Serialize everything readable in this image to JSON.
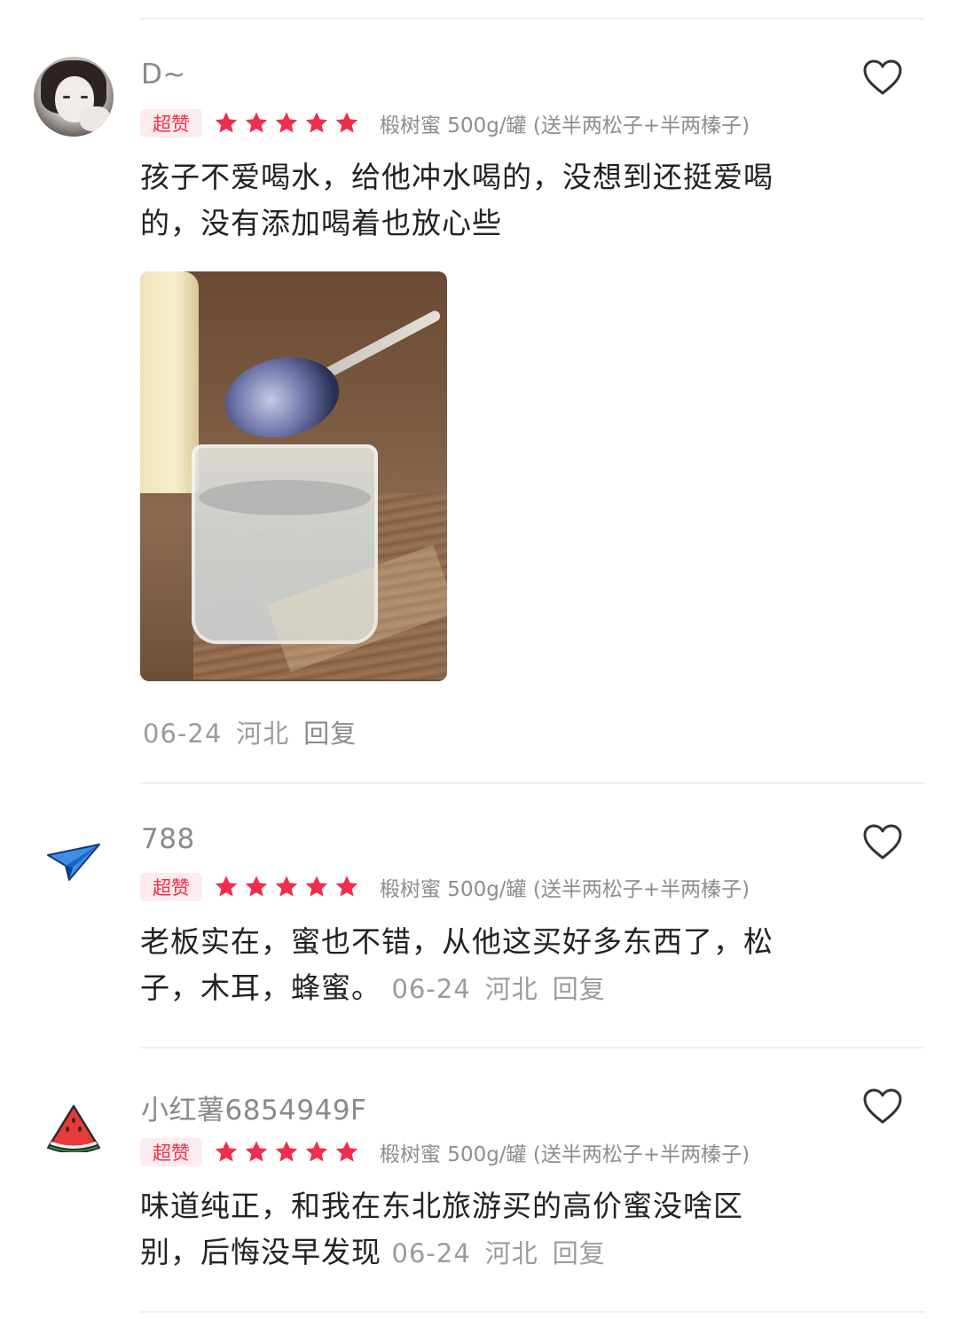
{
  "reviews": [
    {
      "username": "D~",
      "badge": "超赞",
      "stars": 5,
      "variant": "椴树蜜 500g/罐 (送半两松子+半两榛子)",
      "content": "孩子不爱喝水，给他冲水喝的，没想到还挺爱喝的，没有添加喝着也放心些",
      "date": "06-24",
      "location": "河北",
      "reply_label": "回复",
      "avatar_icon": "photo-avatar"
    },
    {
      "username": "788",
      "badge": "超赞",
      "stars": 5,
      "variant": "椴树蜜 500g/罐 (送半两松子+半两榛子)",
      "content": "老板实在，蜜也不错，从他这买好多东西了，松子，木耳，蜂蜜。",
      "date": "06-24",
      "location": "河北",
      "reply_label": "回复",
      "avatar_icon": "paper-plane-icon"
    },
    {
      "username": "小红薯6854949F",
      "badge": "超赞",
      "stars": 5,
      "variant": "椴树蜜 500g/罐 (送半两松子+半两榛子)",
      "content": "味道纯正，和我在东北旅游买的高价蜜没啥区别，后悔没早发现",
      "date": "06-24",
      "location": "河北",
      "reply_label": "回复",
      "avatar_icon": "watermelon-icon"
    }
  ],
  "colors": {
    "accent": "#f02d4b",
    "badge_bg": "#fdecef",
    "text_primary": "#222222",
    "text_secondary": "#8a8a8a"
  }
}
